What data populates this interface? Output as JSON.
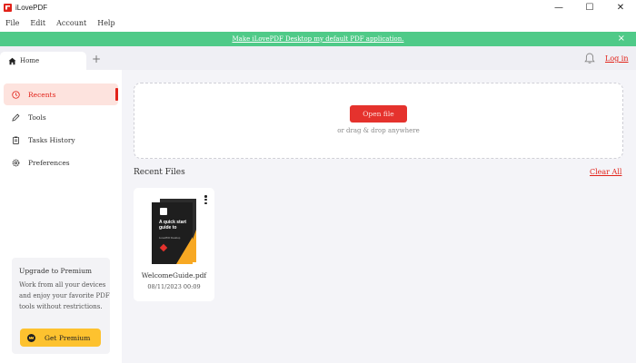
{
  "window": {
    "title": "iLovePDF",
    "controls": {
      "minimize": "—",
      "maximize": "☐",
      "close": "✕"
    }
  },
  "menu": {
    "items": [
      "File",
      "Edit",
      "Account",
      "Help"
    ]
  },
  "banner": {
    "link_text": "Make iLovePDF Desktop my default PDF application.",
    "close": "×",
    "color": "#4fca88"
  },
  "tabs": {
    "home_label": "Home",
    "add": "+",
    "login": "Log in"
  },
  "sidebar": {
    "items": [
      {
        "label": "Recents",
        "icon": "clock-icon",
        "active": true
      },
      {
        "label": "Tools",
        "icon": "pen-icon",
        "active": false
      },
      {
        "label": "Tasks History",
        "icon": "clipboard-icon",
        "active": false
      },
      {
        "label": "Preferences",
        "icon": "gear-icon",
        "active": false
      }
    ],
    "premium": {
      "title": "Upgrade to Premium",
      "text": "Work from all your devices and enjoy your favorite PDF tools without restrictions.",
      "button": "Get Premium"
    }
  },
  "main": {
    "open_button": "Open file",
    "drop_hint": "or drag & drop anywhere",
    "recent_title": "Recent Files",
    "clear_all": "Clear All",
    "files": [
      {
        "name": "WelcomeGuide.pdf",
        "date": "08/11/2023 00:09",
        "thumb_heading": "A quick start guide to",
        "thumb_sub": "iLovePDF Desktop"
      }
    ]
  },
  "colors": {
    "accent": "#e2231a",
    "active_bg": "#fde3de",
    "premium_button": "#fdc22f",
    "main_bg": "#f4f4f8"
  }
}
